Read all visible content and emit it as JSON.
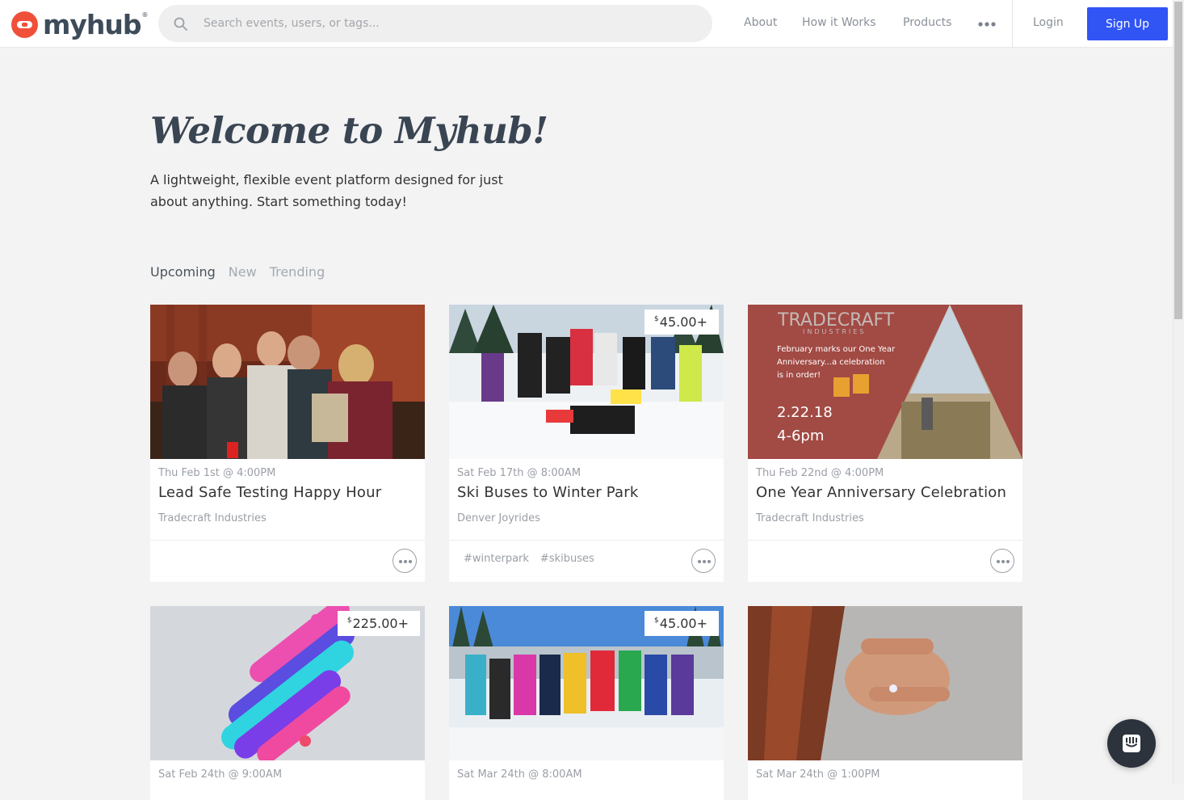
{
  "header": {
    "logo_text": "myhub",
    "logo_reg": "®",
    "search_placeholder": "Search events, users, or tags...",
    "nav": [
      {
        "label": "About"
      },
      {
        "label": "How it Works"
      },
      {
        "label": "Products"
      }
    ],
    "more_icon": "ellipsis-icon",
    "login_label": "Login",
    "signup_label": "Sign Up",
    "accent_color": "#3154f5",
    "brand_color": "#f0503a"
  },
  "hero": {
    "title": "Welcome to Myhub!",
    "subtitle": "A lightweight, flexible event platform designed for just about anything. Start something today!"
  },
  "tabs": [
    {
      "label": "Upcoming",
      "active": true
    },
    {
      "label": "New",
      "active": false
    },
    {
      "label": "Trending",
      "active": false
    }
  ],
  "cards": [
    {
      "date": "Thu Feb 1st @ 4:00PM",
      "title": "Lead Safe Testing Happy Hour",
      "org": "Tradecraft Industries",
      "tags": [],
      "image": "happy-hour-photo"
    },
    {
      "date": "Sat Feb 17th @ 8:00AM",
      "title": "Ski Buses to Winter Park",
      "org": "Denver Joyrides",
      "price_currency": "$",
      "price_amount": "45.00+",
      "tags": [
        "#winterpark",
        "#skibuses"
      ],
      "image": "ski-group-photo"
    },
    {
      "date": "Thu Feb 22nd @ 4:00PM",
      "title": "One Year Anniversary Celebration",
      "org": "Tradecraft Industries",
      "tags": [],
      "image": "anniversary-flyer",
      "flyer": {
        "brand": "TRADECRAFT",
        "brand_sub": "INDUSTRIES",
        "text": "February marks our One Year Anniversary...a celebration is in order!",
        "date": "2.22.18",
        "time": "4-6pm"
      }
    },
    {
      "date": "Sat Feb 24th @ 9:00AM",
      "price_currency": "$",
      "price_amount": "225.00+",
      "image": "abstract-graphic"
    },
    {
      "date": "Sat Mar 24th @ 8:00AM",
      "price_currency": "$",
      "price_amount": "45.00+",
      "image": "ski-group-photo-2"
    },
    {
      "date": "Sat Mar 24th @ 1:00PM",
      "image": "ring-hand-photo"
    }
  ],
  "chat_icon": "chat-icon"
}
